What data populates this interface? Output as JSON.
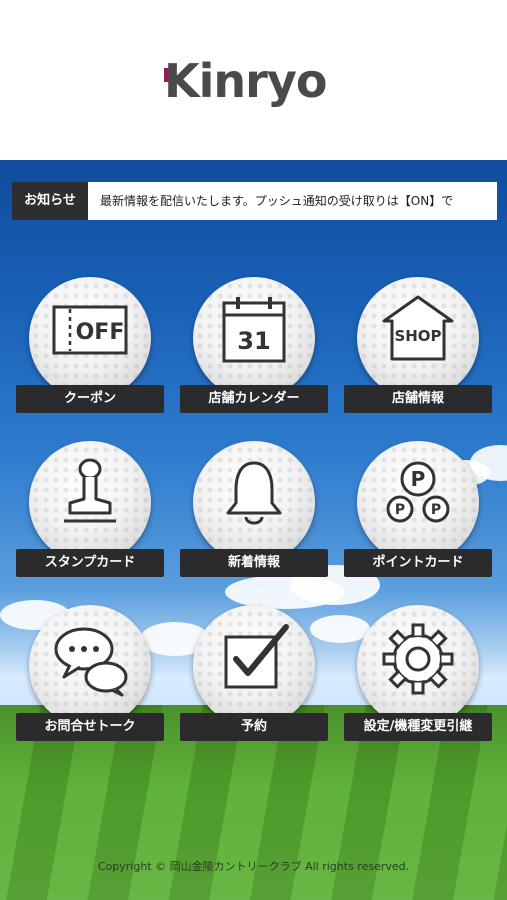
{
  "app": {
    "logo_text": "Kinryo",
    "brand_color": "#a3155a"
  },
  "news": {
    "tag": "お知らせ",
    "message": "最新情報を配信いたします。プッシュ通知の受け取りは【ON】で"
  },
  "menu": [
    {
      "label": "クーポン",
      "icon": "coupon-off-icon",
      "icon_text": "OFF"
    },
    {
      "label": "店舗カレンダー",
      "icon": "calendar-icon",
      "icon_text": "31"
    },
    {
      "label": "店舗情報",
      "icon": "shop-icon",
      "icon_text": "SHOP"
    },
    {
      "label": "スタンプカード",
      "icon": "stamp-icon",
      "icon_text": ""
    },
    {
      "label": "新着情報",
      "icon": "bell-icon",
      "icon_text": ""
    },
    {
      "label": "ポイントカード",
      "icon": "points-icon",
      "icon_text": "P"
    },
    {
      "label": "お問合せトーク",
      "icon": "chat-bubbles-icon",
      "icon_text": ""
    },
    {
      "label": "予約",
      "icon": "checkbox-icon",
      "icon_text": ""
    },
    {
      "label": "設定/機種変更引継",
      "icon": "gear-icon",
      "icon_text": ""
    }
  ],
  "footer": {
    "copyright": "Copyright © 岡山金陵カントリークラブ All rights reserved."
  }
}
